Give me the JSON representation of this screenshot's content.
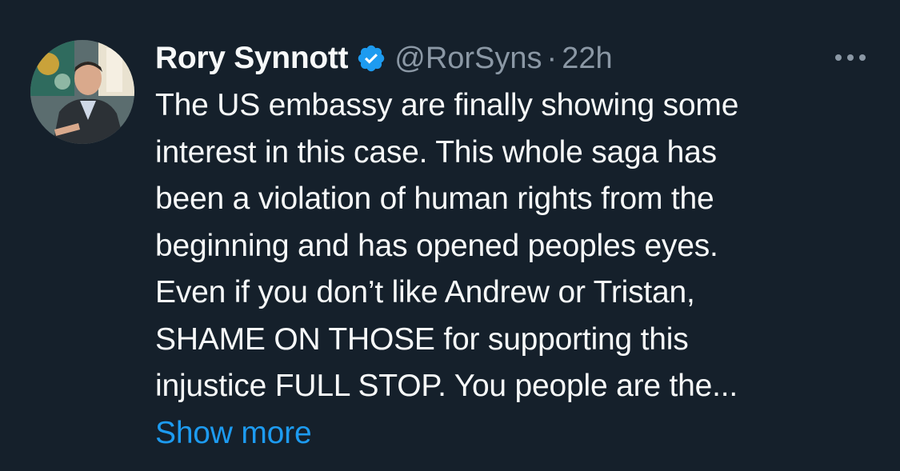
{
  "tweet": {
    "author_name": "Rory Synnott",
    "handle": "@RorSyns",
    "separator": "·",
    "time": "22h",
    "verified": true,
    "body_lines": [
      "The US embassy are finally showing some",
      "interest in this case. This whole saga has",
      "been a violation of human rights from the",
      "beginning and has opened peoples eyes.",
      "Even if you don’t like Andrew or Tristan,",
      "SHAME ON THOSE for supporting this",
      "injustice FULL STOP. You people are the..."
    ],
    "show_more_label": "Show more"
  },
  "icons": {
    "verified": "verified-badge-icon",
    "more": "more-options-icon"
  },
  "colors": {
    "background": "#15202b",
    "text": "#f7f9f9",
    "muted": "#8b98a5",
    "accent": "#1d9bf0"
  }
}
